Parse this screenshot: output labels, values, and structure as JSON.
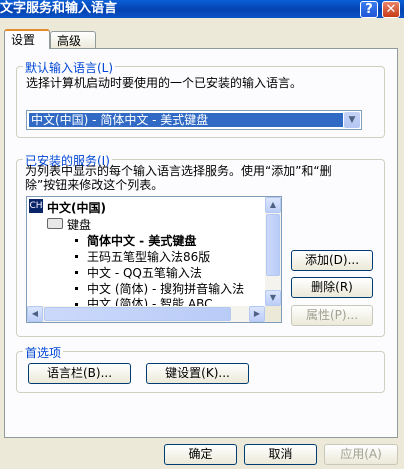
{
  "window": {
    "title": "文字服务和输入语言"
  },
  "tabs": [
    {
      "label": "设置"
    },
    {
      "label": "高级"
    }
  ],
  "default_lang": {
    "legend": "默认输入语言(L)",
    "desc": "选择计算机启动时要使用的一个已安装的输入语言。",
    "selected": "中文(中国) - 简体中文 - 美式键盘"
  },
  "installed": {
    "legend": "已安装的服务(I)",
    "desc1": "为列表中显示的每个输入语言选择服务。使用“添加”和“删",
    "desc2": "除”按钮来修改这个列表。",
    "lang_badge": "CH",
    "lang": "中文(中国)",
    "keyboard": "键盘",
    "services": [
      "简体中文 - 美式键盘",
      "王码五笔型输入法86版",
      "中文 - QQ五笔输入法",
      "中文 (简体) - 搜狗拼音输入法",
      "中文 (简体) - 智能 ABC"
    ]
  },
  "buttons": {
    "add": "添加(D)...",
    "remove": "删除(R)",
    "properties": "属性(P)...",
    "langbar": "语言栏(B)...",
    "keys": "键设置(K)...",
    "ok": "确定",
    "cancel": "取消",
    "apply": "应用(A)"
  },
  "preferences": {
    "legend": "首选项"
  }
}
